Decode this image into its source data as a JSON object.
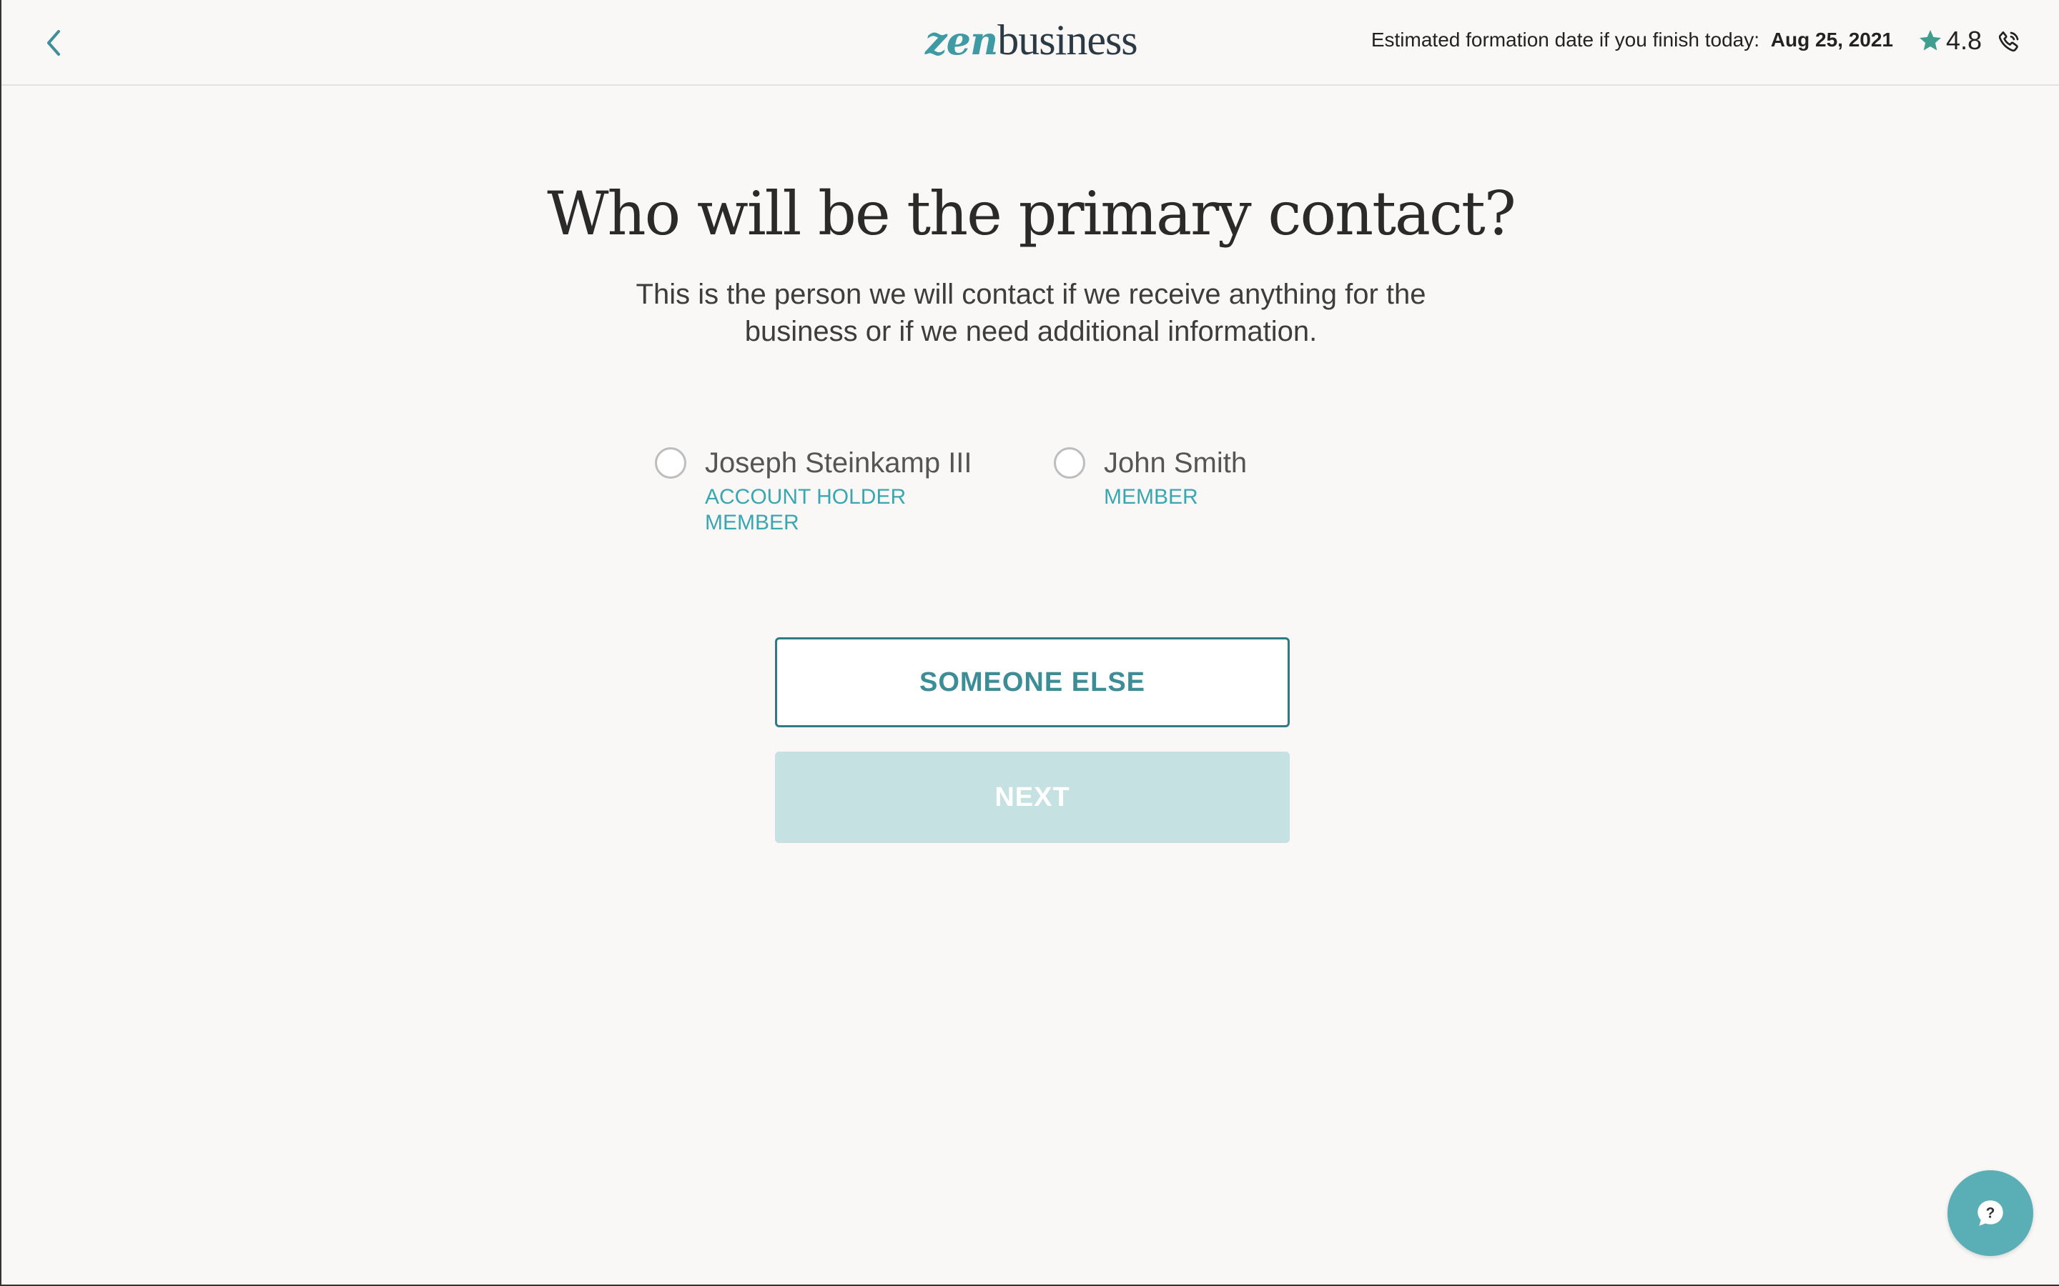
{
  "header": {
    "back_icon": "chevron-left-icon",
    "logo": {
      "zen": "zen",
      "business": "business"
    },
    "formation_label": "Estimated formation date if you finish today:",
    "formation_date": "Aug 25, 2021",
    "rating": "4.8",
    "rating_icon": "star-icon",
    "phone_icon": "phone-icon"
  },
  "main": {
    "title": "Who will be the primary contact?",
    "subtitle": "This is the person we will contact if we receive anything for the business or if we need additional information.",
    "options": [
      {
        "name": "Joseph Steinkamp III",
        "roles": [
          "ACCOUNT HOLDER",
          "MEMBER"
        ]
      },
      {
        "name": "John Smith",
        "roles": [
          "MEMBER"
        ]
      }
    ],
    "someone_else_label": "SOMEONE ELSE",
    "next_label": "NEXT"
  },
  "help": {
    "icon": "help-chat-icon"
  },
  "colors": {
    "accent": "#3e9aa3",
    "role_text": "#3aa7b0",
    "next_disabled_bg": "#c6e1e2",
    "help_bg": "#5aaeb5",
    "page_bg": "#f9f8f6"
  }
}
